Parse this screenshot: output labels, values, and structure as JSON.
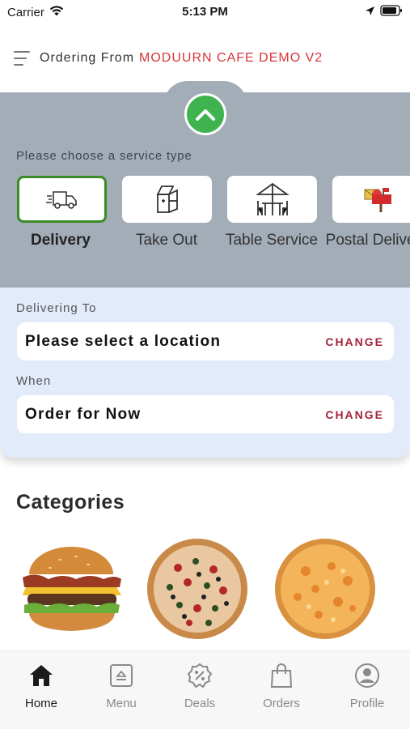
{
  "status_bar": {
    "carrier": "Carrier",
    "time": "5:13 PM"
  },
  "header": {
    "ordering_from": "Ordering From",
    "cafe_name": "MODUURN CAFE DEMO V2"
  },
  "service": {
    "label": "Please choose a service type",
    "options": [
      {
        "name": "Delivery",
        "icon": "delivery-truck-icon",
        "selected": true
      },
      {
        "name": "Take Out",
        "icon": "takeout-bag-icon",
        "selected": false
      },
      {
        "name": "Table Service",
        "icon": "table-umbrella-icon",
        "selected": false
      },
      {
        "name": "Postal Delivery",
        "icon": "mailbox-icon",
        "selected": false
      }
    ]
  },
  "delivering": {
    "label": "Delivering To",
    "value": "Please select a location",
    "action": "CHANGE"
  },
  "when": {
    "label": "When",
    "value": "Order for Now",
    "action": "CHANGE"
  },
  "categories": {
    "title": "Categories",
    "items": [
      {
        "icon": "burger-image"
      },
      {
        "icon": "pizza-veggie-image"
      },
      {
        "icon": "pizza-cheese-image"
      }
    ]
  },
  "tabs": [
    {
      "label": "Home",
      "icon": "home-icon",
      "active": true
    },
    {
      "label": "Menu",
      "icon": "menu-icon",
      "active": false
    },
    {
      "label": "Deals",
      "icon": "deals-icon",
      "active": false
    },
    {
      "label": "Orders",
      "icon": "orders-icon",
      "active": false
    },
    {
      "label": "Profile",
      "icon": "profile-icon",
      "active": false
    }
  ],
  "colors": {
    "accent": "#d9353a",
    "panel": "#a3adb8",
    "info_panel": "#e2ebf9",
    "selected_border": "#3a8a26",
    "up_button": "#3fb34f",
    "change": "#a3243a"
  }
}
